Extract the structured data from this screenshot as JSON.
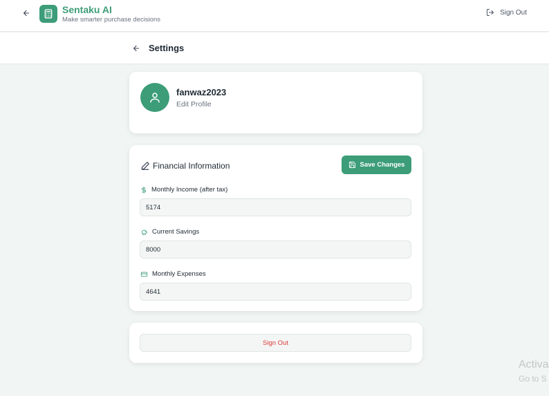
{
  "header": {
    "title": "Sentaku AI",
    "subtitle": "Make smarter purchase decisions",
    "signout_label": "Sign Out"
  },
  "settings": {
    "title": "Settings"
  },
  "profile": {
    "username": "fanwaz2023",
    "edit_label": "Edit Profile"
  },
  "financial": {
    "title": "Financial Information",
    "save_label": "Save Changes",
    "fields": [
      {
        "label": "Monthly Income (after tax)",
        "value": "5174",
        "icon": "dollar-icon"
      },
      {
        "label": "Current Savings",
        "value": "8000",
        "icon": "piggy-bank-icon"
      },
      {
        "label": "Monthly Expenses",
        "value": "4641",
        "icon": "credit-card-icon"
      }
    ]
  },
  "account": {
    "signout_label": "Sign Out"
  },
  "watermark": {
    "line1": "Activa",
    "line2": "Go to S"
  },
  "colors": {
    "brand": "#3c9d78",
    "danger": "#dc3b3b",
    "background": "#f1f5f3"
  }
}
